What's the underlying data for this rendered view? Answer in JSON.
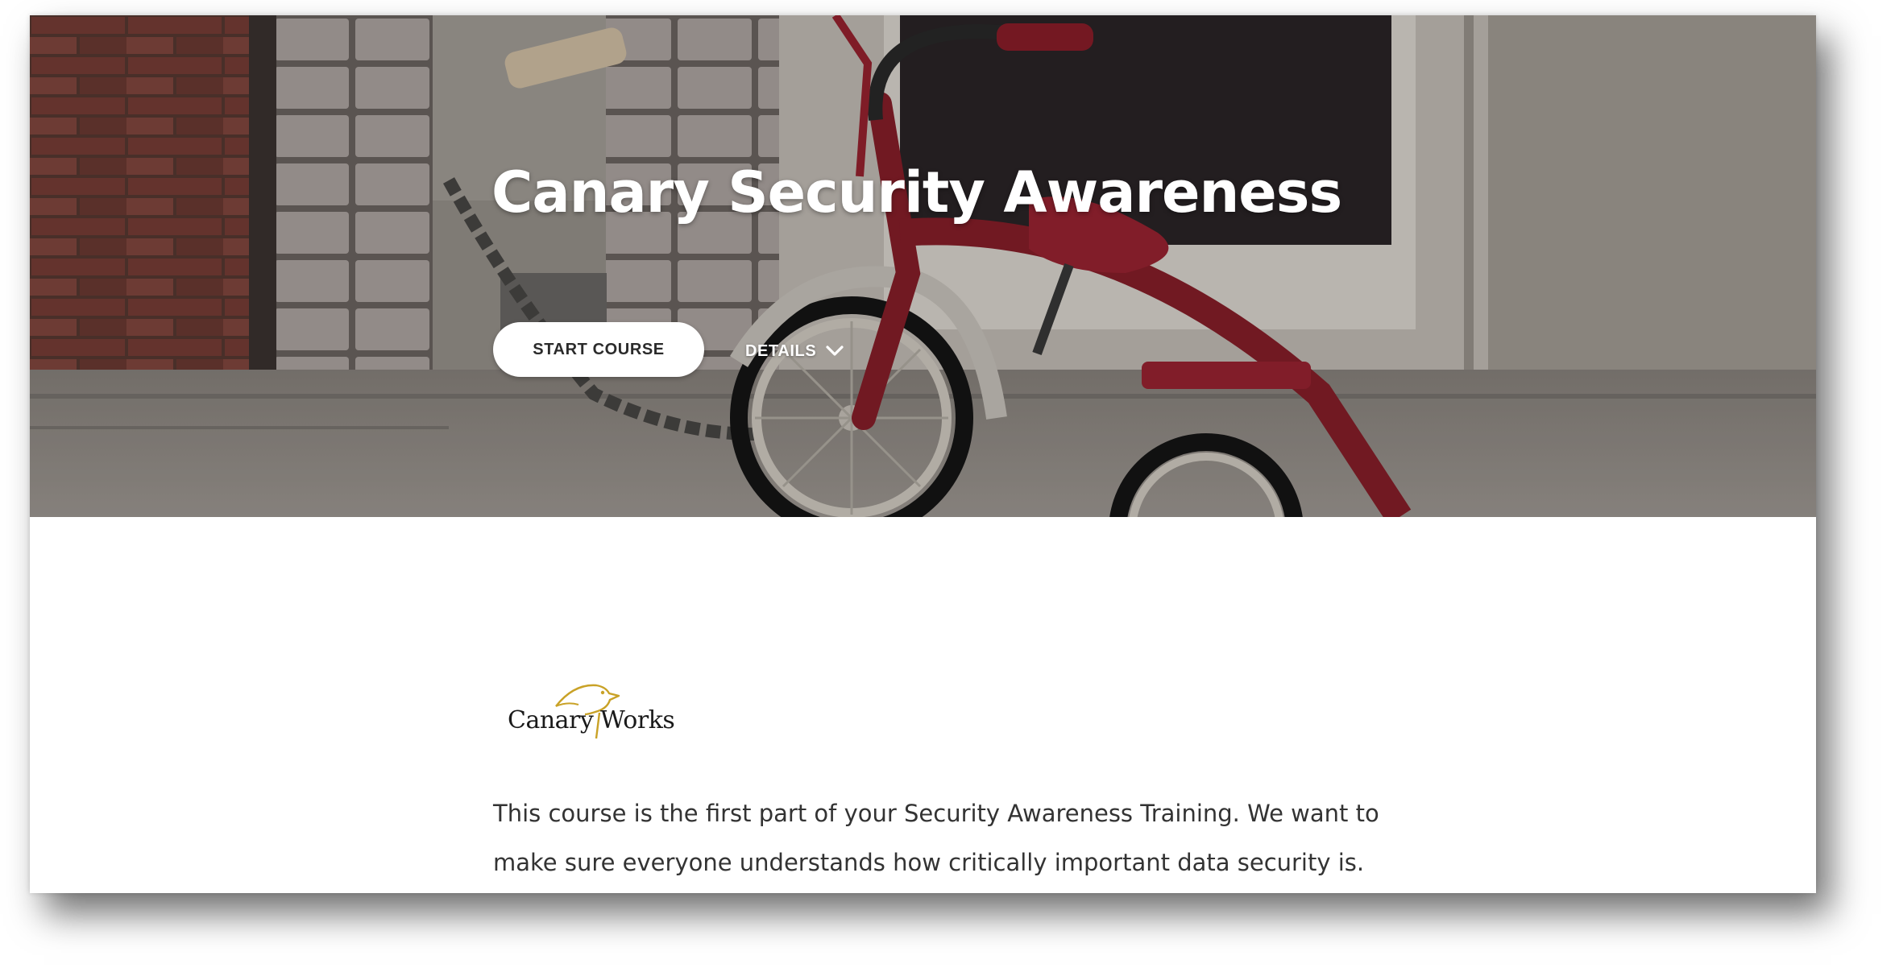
{
  "course": {
    "title": "Canary Security Awareness",
    "start_label": "START COURSE",
    "details_label": "DETAILS",
    "details_icon": "chevron-down-icon",
    "description": "This course is the first part of your Security Awareness Training. We want to make sure everyone understands how critically important data security is."
  },
  "logo": {
    "word_left": "Canary",
    "word_right": "Works",
    "bird_color": "#c9a227"
  },
  "colors": {
    "button_bg": "#ffffff",
    "button_text": "#2b2b2b",
    "title_text": "#ffffff",
    "body_text": "#333333"
  }
}
